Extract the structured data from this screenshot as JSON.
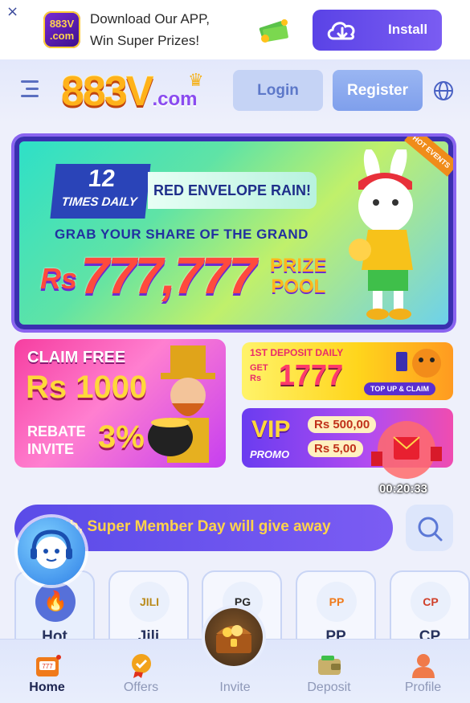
{
  "download_bar": {
    "close": "×",
    "logo_line1": "883V",
    "logo_line2": ".com",
    "line1": "Download Our APP,",
    "line2": "Win Super Prizes!",
    "install_label": "Install"
  },
  "header": {
    "brand": "883V",
    "brand_suffix": ".com",
    "login_label": "Login",
    "register_label": "Register"
  },
  "main_banner": {
    "times_number": "12",
    "times_text": "TIMES DAILY",
    "red_envelope": "RED ENVELOPE RAIN!",
    "grab_text": "GRAB YOUR SHARE OF THE GRAND",
    "currency": "Rs",
    "amount": "777,777",
    "prize_line1": "PRIZE",
    "prize_line2": "POOL",
    "hot_tag": "HOT EVENTS"
  },
  "promo_left": {
    "claim": "CLAIM FREE",
    "amount": "Rs 1000",
    "rebate_line1": "REBATE",
    "rebate_line2": "INVITE",
    "percent": "3%"
  },
  "promo_right_top": {
    "first_deposit": "1ST DEPOSIT DAILY",
    "get_line1": "GET",
    "get_line2": "Rs",
    "amount": "1777",
    "top_up": "TOP UP & CLAIM"
  },
  "promo_right_bottom": {
    "vip": "VIP",
    "promo": "PROMO",
    "amount_a": "Rs 500,00",
    "amount_b": "Rs 5,00"
  },
  "timer": "00:20:33",
  "marquee": {
    "text": "th, Super Member Day will give away"
  },
  "categories": [
    {
      "label": "Hot",
      "icon": "flame-icon"
    },
    {
      "label": "Jili",
      "icon_text": "JILI"
    },
    {
      "label": "PG",
      "icon_text": "PG"
    },
    {
      "label": "PP",
      "icon_text": "PP"
    },
    {
      "label": "CP",
      "icon_text": "CP"
    }
  ],
  "bottom_nav": {
    "behind_text": "me",
    "items": [
      {
        "label": "Home"
      },
      {
        "label": "Offers"
      },
      {
        "label": "Invite"
      },
      {
        "label": "Deposit"
      },
      {
        "label": "Profile"
      }
    ]
  },
  "colors": {
    "accent": "#5a43e6",
    "marquee_text": "#ffd34a",
    "nav_active": "#1c2450",
    "nav_inactive": "#8e98b8"
  }
}
